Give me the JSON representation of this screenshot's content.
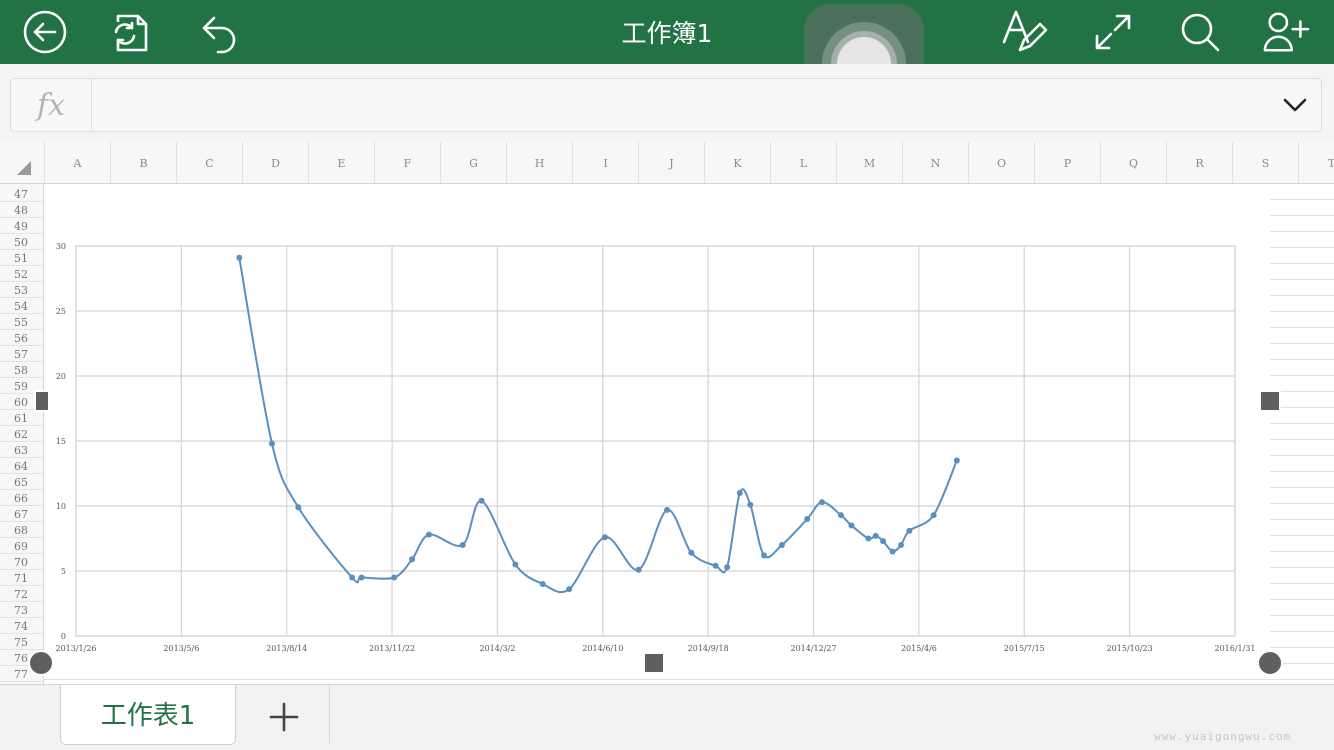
{
  "header": {
    "title": "工作簿1",
    "icons": [
      "back-arrow-icon",
      "save-sync-icon",
      "undo-icon",
      "edit-text-icon",
      "fullscreen-icon",
      "search-icon",
      "add-person-icon"
    ]
  },
  "formula_bar": {
    "fx_label": "fx",
    "value": ""
  },
  "columns": [
    "A",
    "B",
    "C",
    "D",
    "E",
    "F",
    "G",
    "H",
    "I",
    "J",
    "K",
    "L",
    "M",
    "N",
    "O",
    "P",
    "Q",
    "R",
    "S",
    "T"
  ],
  "rows": [
    "47",
    "48",
    "49",
    "50",
    "51",
    "52",
    "53",
    "54",
    "55",
    "56",
    "57",
    "58",
    "59",
    "60",
    "61",
    "62",
    "63",
    "64",
    "65",
    "66",
    "67",
    "68",
    "69",
    "70",
    "71",
    "72",
    "73",
    "74",
    "75",
    "76",
    "77"
  ],
  "chart_data": {
    "type": "line",
    "title": "",
    "xlabel": "",
    "ylabel": "",
    "ylim": [
      0,
      30
    ],
    "yticks": [
      "0",
      "5",
      "10",
      "15",
      "20",
      "25",
      "30"
    ],
    "x_tick_labels": [
      "2013/1/26",
      "2013/5/6",
      "2013/8/14",
      "2013/11/22",
      "2014/3/2",
      "2014/6/10",
      "2014/9/18",
      "2014/12/27",
      "2015/4/6",
      "2015/7/15",
      "2015/10/23",
      "2016/1/31"
    ],
    "x_range": [
      "2013/1/26",
      "2016/1/31"
    ],
    "grid": true,
    "line_color": "#5b8fbf",
    "series": [
      {
        "points": [
          {
            "x": "2013/6/30",
            "y": 29.1
          },
          {
            "x": "2013/7/31",
            "y": 14.8
          },
          {
            "x": "2013/8/25",
            "y": 9.9
          },
          {
            "x": "2013/10/15",
            "y": 4.5
          },
          {
            "x": "2013/10/24",
            "y": 4.5
          },
          {
            "x": "2013/11/24",
            "y": 4.5
          },
          {
            "x": "2013/12/11",
            "y": 5.9
          },
          {
            "x": "2013/12/27",
            "y": 7.8
          },
          {
            "x": "2014/1/28",
            "y": 7.0
          },
          {
            "x": "2014/2/15",
            "y": 10.4
          },
          {
            "x": "2014/3/19",
            "y": 5.5
          },
          {
            "x": "2014/4/14",
            "y": 4.0
          },
          {
            "x": "2014/5/9",
            "y": 3.6
          },
          {
            "x": "2014/6/12",
            "y": 7.6
          },
          {
            "x": "2014/7/14",
            "y": 5.1
          },
          {
            "x": "2014/8/10",
            "y": 9.7
          },
          {
            "x": "2014/9/2",
            "y": 6.4
          },
          {
            "x": "2014/9/25",
            "y": 5.4
          },
          {
            "x": "2014/10/6",
            "y": 5.3
          },
          {
            "x": "2014/10/18",
            "y": 11.0
          },
          {
            "x": "2014/10/28",
            "y": 10.1
          },
          {
            "x": "2014/11/10",
            "y": 6.2
          },
          {
            "x": "2014/11/27",
            "y": 7.0
          },
          {
            "x": "2014/12/21",
            "y": 9.0
          },
          {
            "x": "2015/1/4",
            "y": 10.3
          },
          {
            "x": "2015/1/22",
            "y": 9.3
          },
          {
            "x": "2015/2/1",
            "y": 8.5
          },
          {
            "x": "2015/2/17",
            "y": 7.5
          },
          {
            "x": "2015/2/24",
            "y": 7.7
          },
          {
            "x": "2015/3/3",
            "y": 7.3
          },
          {
            "x": "2015/3/12",
            "y": 6.5
          },
          {
            "x": "2015/3/20",
            "y": 7.0
          },
          {
            "x": "2015/3/28",
            "y": 8.1
          },
          {
            "x": "2015/4/20",
            "y": 9.3
          },
          {
            "x": "2015/5/12",
            "y": 13.5
          }
        ]
      }
    ]
  },
  "sheets": {
    "tab1": "工作表1",
    "add_label": "+"
  },
  "watermark": "www.yuaigongwu.com"
}
